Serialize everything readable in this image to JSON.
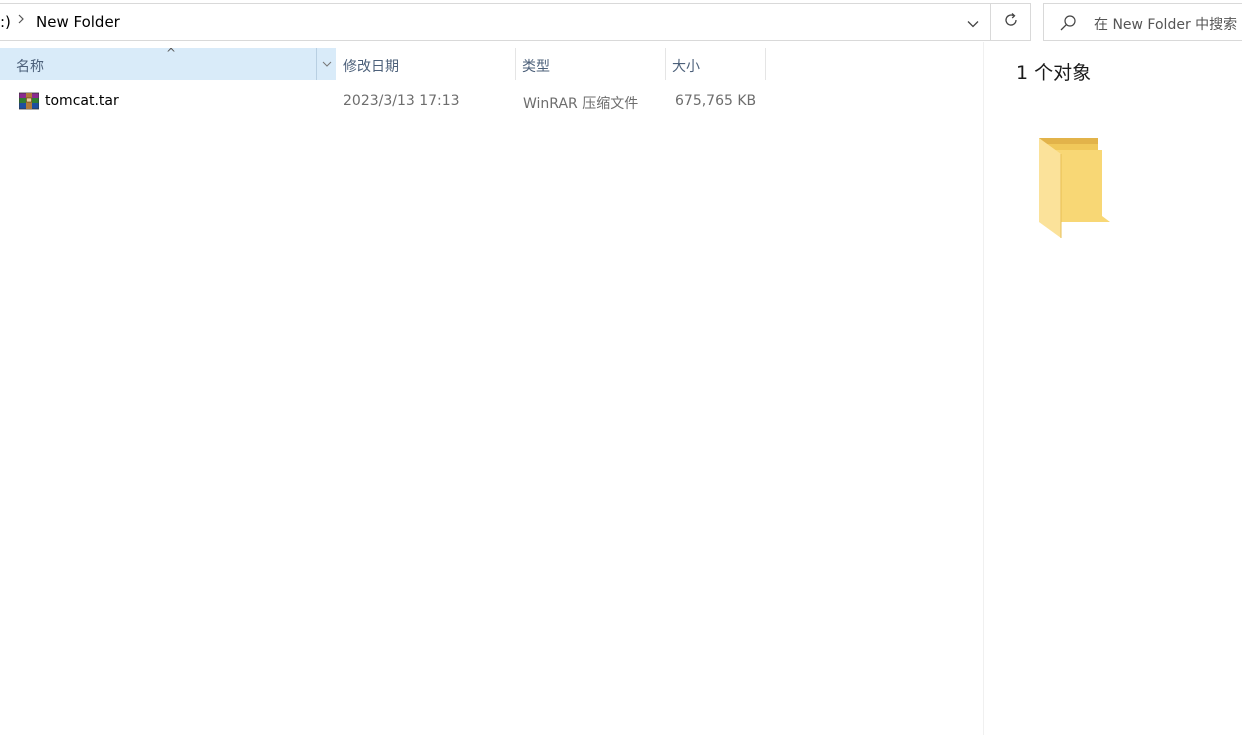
{
  "address_bar": {
    "prefix": ":)",
    "separator": ">",
    "current_folder": "New Folder"
  },
  "search": {
    "placeholder": "在 New Folder 中搜索"
  },
  "columns": {
    "name": "名称",
    "date_modified": "修改日期",
    "type": "类型",
    "size": "大小",
    "sort_indicator": "^"
  },
  "files": [
    {
      "name": "tomcat.tar",
      "date_modified": "2023/3/13 17:13",
      "type": "WinRAR 压缩文件",
      "size": "675,765 KB",
      "icon": "winrar-archive-icon"
    }
  ],
  "preview": {
    "item_count": "1 个对象",
    "icon": "folder-icon"
  },
  "colors": {
    "selected_header_bg": "#d9ebf9",
    "header_text": "#4c607a",
    "secondary_text": "#6d6d6d",
    "folder_yellow": "#f8d775"
  }
}
